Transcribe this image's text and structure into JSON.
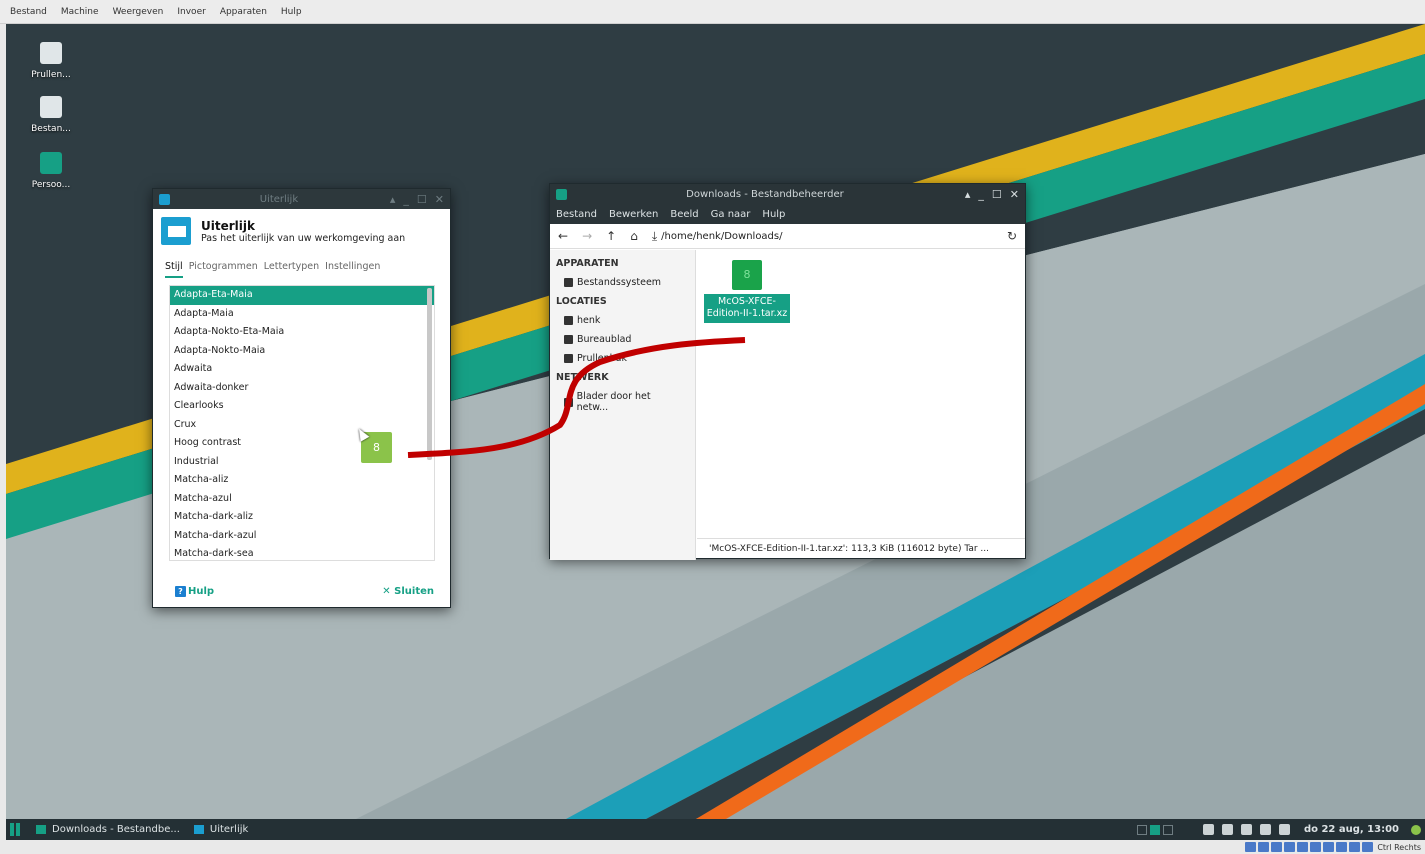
{
  "host_menu": [
    "Bestand",
    "Machine",
    "Weergeven",
    "Invoer",
    "Apparaten",
    "Hulp"
  ],
  "desktop_icons": [
    {
      "label": "Prullen...",
      "icon": "trash-icon",
      "color": "#e0e6e8"
    },
    {
      "label": "Bestan...",
      "icon": "drive-icon",
      "color": "#e0e6e8"
    },
    {
      "label": "Persoo...",
      "icon": "home-folder-icon",
      "color": "#16a085"
    }
  ],
  "appearance": {
    "window_title": "Uiterlijk",
    "heading": "Uiterlijk",
    "subtitle": "Pas het uiterlijk van uw werkomgeving aan",
    "tabs": [
      "Stijl",
      "Pictogrammen",
      "Lettertypen",
      "Instellingen"
    ],
    "active_tab": "Stijl",
    "styles": [
      "Adapta-Eta-Maia",
      "Adapta-Maia",
      "Adapta-Nokto-Eta-Maia",
      "Adapta-Nokto-Maia",
      "Adwaita",
      "Adwaita-donker",
      "Clearlooks",
      "Crux",
      "Hoog contrast",
      "Industrial",
      "Matcha-aliz",
      "Matcha-azul",
      "Matcha-dark-aliz",
      "Matcha-dark-azul",
      "Matcha-dark-sea"
    ],
    "selected_style": "Adapta-Eta-Maia",
    "help_label": "Hulp",
    "close_label": "Sluiten"
  },
  "file_manager": {
    "window_title": "Downloads - Bestandbeheerder",
    "menu": [
      "Bestand",
      "Bewerken",
      "Beeld",
      "Ga naar",
      "Hulp"
    ],
    "path": "/home/henk/Downloads/",
    "sections": {
      "devices": "APPARATEN",
      "locations": "LOCATIES",
      "network": "NETWERK"
    },
    "devices": [
      "Bestandssysteem"
    ],
    "locations": [
      "henk",
      "Bureaublad",
      "Prullenbak"
    ],
    "network": [
      "Blader door het netw..."
    ],
    "file_name": "McOS-XFCE-Edition-II-1.tar.xz",
    "status": "'McOS-XFCE-Edition-II-1.tar.xz': 113,3 KiB (116012 byte) Tar ..."
  },
  "drag_icon_glyph": "8",
  "taskbar": {
    "tasks": [
      "Downloads - Bestandbe...",
      "Uiterlijk"
    ],
    "clock": "do 22 aug, 13:00"
  },
  "vb_status": {
    "host_key": "Ctrl Rechts"
  },
  "colors": {
    "accent": "#16a085",
    "stroke": "#c00000"
  }
}
